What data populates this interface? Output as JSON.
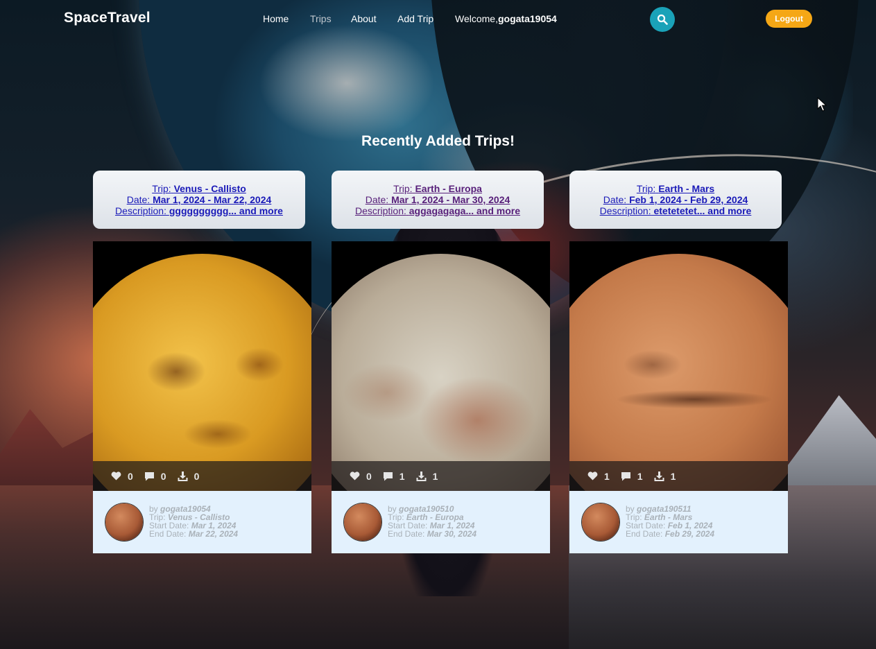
{
  "nav": {
    "brand": "SpaceTravel",
    "links": [
      "Home",
      "Trips",
      "About",
      "Add Trip"
    ],
    "welcome_prefix": "Welcome,",
    "username": "gogata19054",
    "logout_label": "Logout"
  },
  "section_title": "Recently Added Trips!",
  "summaries": [
    {
      "trip_label": "Trip:",
      "trip": "Venus - Callisto",
      "date_label": "Date:",
      "date": "Mar 1, 2024 - Mar 22, 2024",
      "desc_label": "Description:",
      "desc": "gggggggggg... and more"
    },
    {
      "trip_label": "Trip:",
      "trip": "Earth - Europa",
      "date_label": "Date:",
      "date": "Mar 1, 2024 - Mar 30, 2024",
      "desc_label": "Description:",
      "desc": "aggagagaga... and more"
    },
    {
      "trip_label": "Trip:",
      "trip": "Earth - Mars",
      "date_label": "Date:",
      "date": "Feb 1, 2024 - Feb 29, 2024",
      "desc_label": "Description:",
      "desc": "etetetetet... and more"
    }
  ],
  "cards": [
    {
      "likes": "0",
      "comments": "0",
      "downloads": "0",
      "by_label": "by",
      "author": "gogata19054",
      "trip_label": "Trip:",
      "trip": "Venus - Callisto",
      "start_label": "Start Date:",
      "start": "Mar 1, 2024",
      "end_label": "End Date:",
      "end": "Mar 22, 2024"
    },
    {
      "likes": "0",
      "comments": "1",
      "downloads": "1",
      "by_label": "by",
      "author": "gogata190510",
      "trip_label": "Trip:",
      "trip": "Earth - Europa",
      "start_label": "Start Date:",
      "start": "Mar 1, 2024",
      "end_label": "End Date:",
      "end": "Mar 30, 2024"
    },
    {
      "likes": "1",
      "comments": "1",
      "downloads": "1",
      "by_label": "by",
      "author": "gogata190511",
      "trip_label": "Trip:",
      "trip": "Earth - Mars",
      "start_label": "Start Date:",
      "start": "Feb 1, 2024",
      "end_label": "End Date:",
      "end": "Feb 29, 2024"
    }
  ],
  "icons": {
    "search": "search-icon",
    "like": "heart-icon",
    "comment": "comment-icon",
    "download": "download-icon"
  },
  "colors": {
    "search_button": "#1aa2b8",
    "logout_button": "#f5a716",
    "card_info_bg": "#e3f1fd",
    "link": "#1a1ab8"
  }
}
